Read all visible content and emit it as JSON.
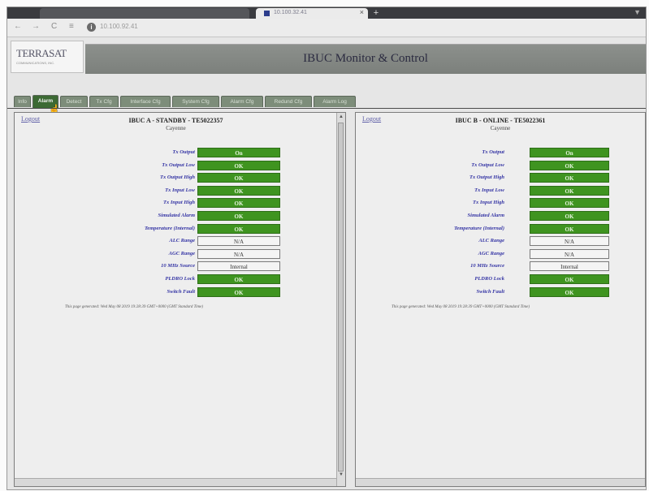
{
  "browser": {
    "tabs": [
      {
        "title": ""
      },
      {
        "title": "10.100.32.41"
      }
    ],
    "address": "10.100.92.41",
    "new_tab": "+",
    "nav": {
      "back": "←",
      "forward": "→",
      "reload": "C",
      "home": "≡"
    }
  },
  "header": {
    "logo_text": "TERRASAT",
    "logo_sub": "COMMUNICATIONS, INC.",
    "title": "IBUC Monitor & Control"
  },
  "tabs": [
    {
      "label": "Info"
    },
    {
      "label": "Alarm"
    },
    {
      "label": "Detect"
    },
    {
      "label": "Tx Cfg"
    },
    {
      "label": "Interface Cfg"
    },
    {
      "label": "System Cfg"
    },
    {
      "label": "Alarm Cfg"
    },
    {
      "label": "Redund Cfg"
    },
    {
      "label": "Alarm Log"
    }
  ],
  "active_tab": "Alarm",
  "panel_a": {
    "logout": "Logout",
    "title": "IBUC A - STANDBY - TE5022357",
    "subtitle": "Cayenne",
    "rows": [
      {
        "label": "Tx Output",
        "value": "On",
        "status": "ok"
      },
      {
        "label": "Tx Output Low",
        "value": "OK",
        "status": "ok"
      },
      {
        "label": "Tx Output High",
        "value": "OK",
        "status": "ok"
      },
      {
        "label": "Tx Input Low",
        "value": "OK",
        "status": "ok"
      },
      {
        "label": "Tx Input High",
        "value": "OK",
        "status": "ok"
      },
      {
        "label": "Simulated Alarm",
        "value": "OK",
        "status": "ok"
      },
      {
        "label": "Temperature (Internal)",
        "value": "OK",
        "status": "ok"
      },
      {
        "label": "ALC Range",
        "value": "N/A",
        "status": "neutral"
      },
      {
        "label": "AGC Range",
        "value": "N/A",
        "status": "neutral"
      },
      {
        "label": "10 MHz Source",
        "value": "Internal",
        "status": "neutral"
      },
      {
        "label": "PLDRO Lock",
        "value": "OK",
        "status": "ok"
      },
      {
        "label": "Switch Fault",
        "value": "OK",
        "status": "ok"
      }
    ],
    "footer": "This page generated: Wed May 08 2019 19:28:39 GMT+0000 (GMT Standard Time)"
  },
  "panel_b": {
    "logout": "Logout",
    "title": "IBUC B - ONLINE - TE5022361",
    "subtitle": "Cayenne",
    "rows": [
      {
        "label": "Tx Output",
        "value": "On",
        "status": "ok"
      },
      {
        "label": "Tx Output Low",
        "value": "OK",
        "status": "ok"
      },
      {
        "label": "Tx Output High",
        "value": "OK",
        "status": "ok"
      },
      {
        "label": "Tx Input Low",
        "value": "OK",
        "status": "ok"
      },
      {
        "label": "Tx Input High",
        "value": "OK",
        "status": "ok"
      },
      {
        "label": "Simulated Alarm",
        "value": "OK",
        "status": "ok"
      },
      {
        "label": "Temperature (Internal)",
        "value": "OK",
        "status": "ok"
      },
      {
        "label": "ALC Range",
        "value": "N/A",
        "status": "neutral"
      },
      {
        "label": "AGC Range",
        "value": "N/A",
        "status": "neutral"
      },
      {
        "label": "10 MHz Source",
        "value": "Internal",
        "status": "neutral"
      },
      {
        "label": "PLDRO Lock",
        "value": "OK",
        "status": "ok"
      },
      {
        "label": "Switch Fault",
        "value": "OK",
        "status": "ok"
      }
    ],
    "footer": "This page generated: Wed May 08 2019 19:28:39 GMT+0000 (GMT Standard Time)"
  },
  "colors": {
    "ok": "#3f9420",
    "neutral": "#f4f4f4",
    "label": "#3434a4",
    "active_tab": "#3c6a34"
  }
}
